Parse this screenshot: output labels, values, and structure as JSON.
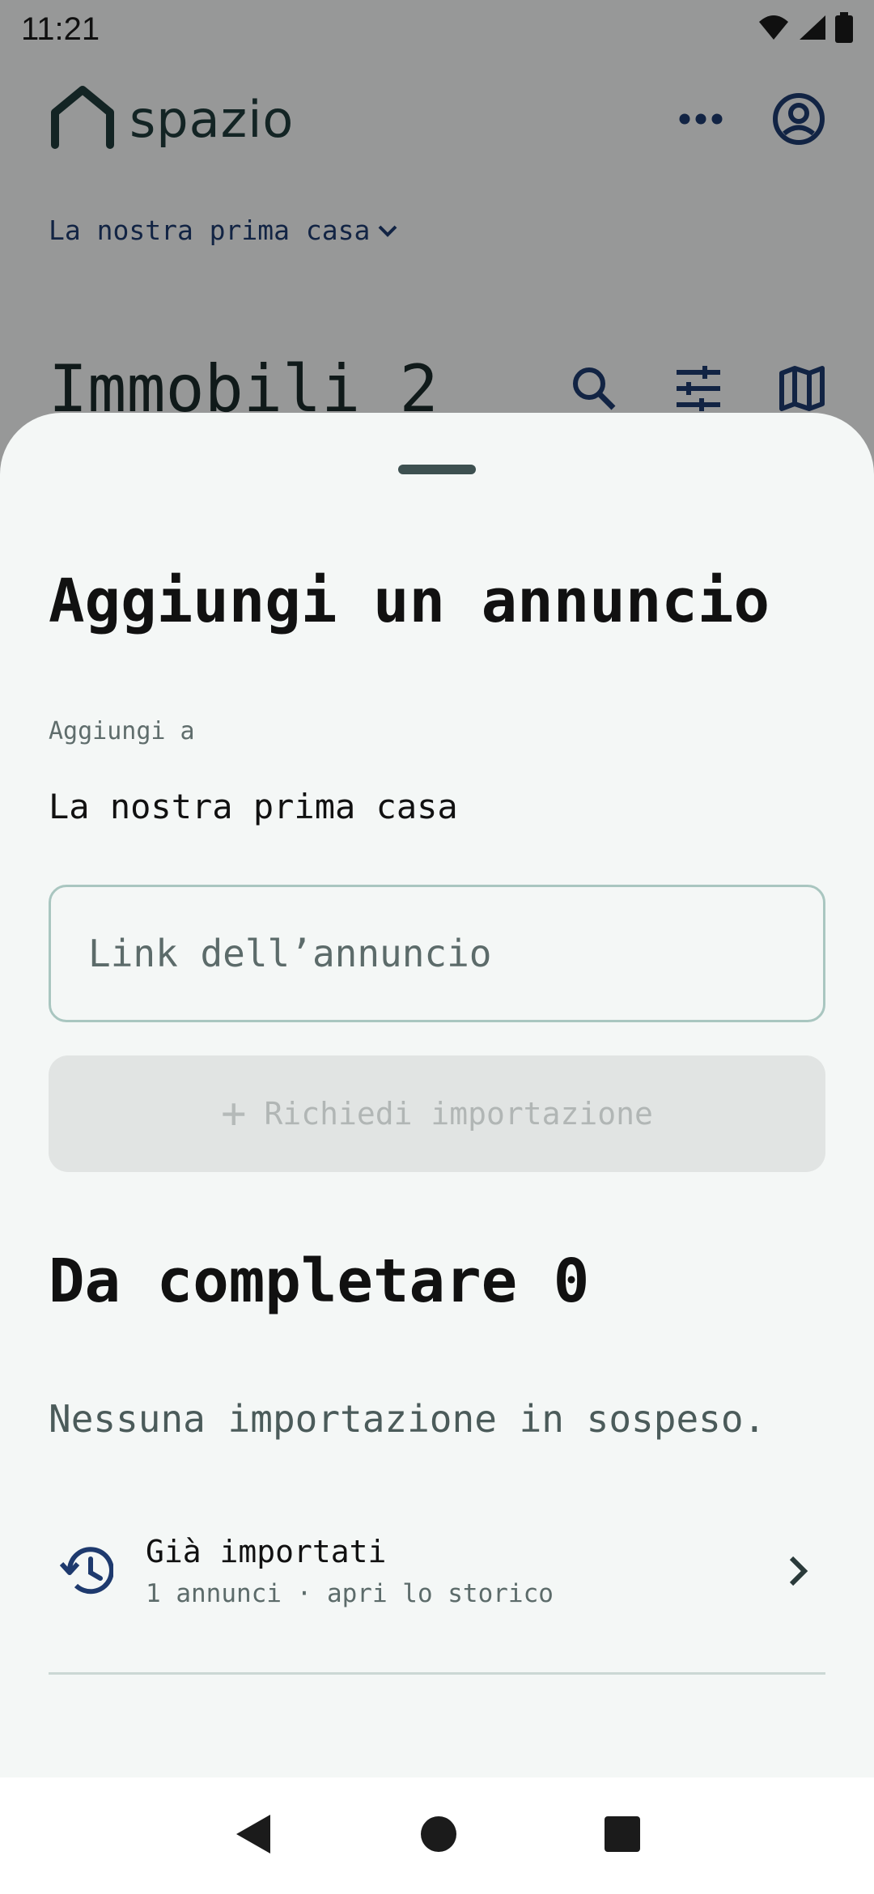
{
  "status_bar": {
    "time": "11:21",
    "icons": [
      "wifi-icon",
      "cellular-signal-icon",
      "battery-icon"
    ]
  },
  "app_header": {
    "brand_name": "spazio",
    "icons": [
      "home-logo-icon",
      "more-options-icon",
      "account-circle-icon"
    ]
  },
  "collection_selector": {
    "label": "La nostra prima casa",
    "icon": "chevron-down-icon"
  },
  "listing_header": {
    "title": "Immobili 2",
    "tools": [
      "search-icon",
      "filter-sliders-icon",
      "map-icon"
    ]
  },
  "sheet": {
    "title": "Aggiungi un annuncio",
    "add_to_label": "Aggiungi a",
    "add_to_value": "La nostra prima casa",
    "link_field": {
      "placeholder": "Link dell’annuncio",
      "value": ""
    },
    "import_button": {
      "icon": "plus-icon",
      "label": "Richiedi importazione",
      "enabled": false
    },
    "pending": {
      "title": "Da completare 0",
      "empty_message": "Nessuna importazione in sospeso."
    },
    "imported": {
      "title": "Già importati",
      "subtitle": "1 annunci · apri lo storico",
      "icon": "history-icon",
      "trailing_icon": "chevron-right-icon"
    }
  },
  "nav_bar": {
    "buttons": [
      "back-icon",
      "home-icon",
      "recents-icon"
    ]
  },
  "colors": {
    "accent": "#1e3a6e",
    "sheet_background": "#f4f7f6",
    "scrim": "rgba(0,0,0,0.38)",
    "disabled_button": "#e1e4e3",
    "field_border": "#a9c6c0"
  }
}
